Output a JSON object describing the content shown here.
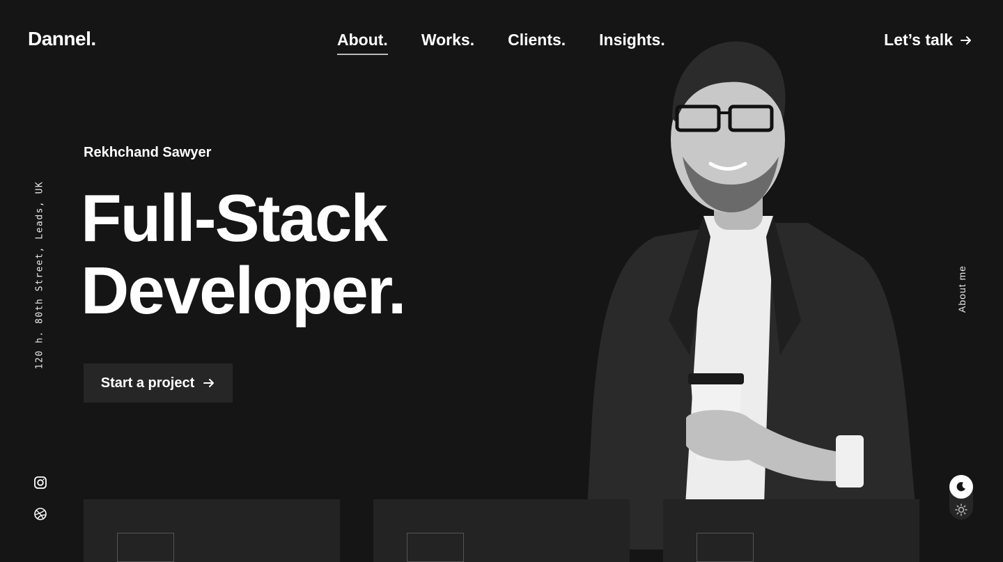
{
  "brand": {
    "logo": "Dannel."
  },
  "nav": {
    "items": [
      {
        "label": "About."
      },
      {
        "label": "Works."
      },
      {
        "label": "Clients."
      },
      {
        "label": "Insights."
      }
    ],
    "active": "About."
  },
  "header": {
    "cta_label": "Let’s talk",
    "cta_icon": "arrow-right-icon"
  },
  "hero": {
    "name": "Rekhchand Sawyer",
    "title_line1": "Full-Stack",
    "title_line2": "Developer.",
    "button_label": "Start a project",
    "button_icon": "arrow-right-icon",
    "photo": "portrait-man-glasses-coffee"
  },
  "sidebar": {
    "address": "120 h. 80th Street, Leads, UK",
    "social": [
      "instagram-icon",
      "dribbble-icon"
    ]
  },
  "right_rail": {
    "label": "About me"
  },
  "theme_toggle": {
    "options": [
      "dark-mode-icon",
      "light-mode-icon"
    ],
    "selected": "dark"
  },
  "colors": {
    "background": "#151515",
    "surface": "#262626",
    "card": "#232323",
    "text": "#ffffff"
  }
}
